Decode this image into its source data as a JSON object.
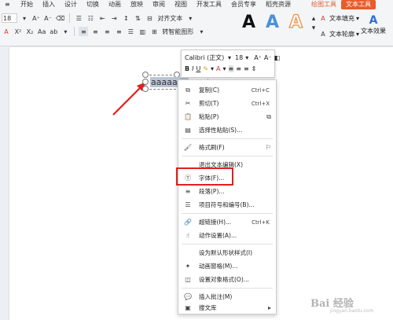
{
  "ribbon": {
    "tabs": [
      "开始",
      "插入",
      "设计",
      "切换",
      "动画",
      "放映",
      "审阅",
      "视图",
      "开发工具",
      "会员专享",
      "稻壳资源"
    ],
    "context_tabs": [
      "绘图工具",
      "文本工具"
    ],
    "font_size": "18",
    "btn_align_text": "对齐文本",
    "btn_smartart": "转智能图形",
    "btn_text_fill": "文本填充",
    "btn_text_outline": "文本轮廓",
    "btn_text_effects": "文本效果",
    "wordart_letters": [
      "A",
      "A",
      "A"
    ],
    "colors": {
      "accent": "#e85d2c",
      "wordart_black": "#111111",
      "wordart_blue": "#4a90d9",
      "wordart_orange": "#f08a3c"
    }
  },
  "minibar": {
    "font_name": "Calibri (正文)",
    "font_size": "18"
  },
  "textbox": {
    "text": "aaaaaaa"
  },
  "menu": {
    "items": [
      {
        "label": "复制(C)",
        "shortcut": "Ctrl+C",
        "icon": "copy-icon",
        "glyph": "⧉"
      },
      {
        "label": "剪切(T)",
        "shortcut": "Ctrl+X",
        "icon": "scissors-icon",
        "glyph": "✂"
      },
      {
        "label": "粘贴(P)",
        "shortcut": "",
        "icon": "paste-icon",
        "glyph": "📋"
      },
      {
        "label": "选择性粘贴(S)...",
        "shortcut": "",
        "icon": "paste-special-icon",
        "glyph": "▤"
      },
      {
        "label": "格式刷(F)",
        "shortcut": "",
        "icon": "format-painter-icon",
        "glyph": "🖌"
      },
      {
        "label": "退出文本编辑(X)",
        "shortcut": "",
        "icon": "",
        "glyph": ""
      },
      {
        "label": "字体(F)...",
        "shortcut": "",
        "icon": "font-icon",
        "glyph": "Ⓣ"
      },
      {
        "label": "段落(P)...",
        "shortcut": "",
        "icon": "paragraph-icon",
        "glyph": "≡"
      },
      {
        "label": "项目符号和编号(B)...",
        "shortcut": "",
        "icon": "bullets-icon",
        "glyph": "☰"
      },
      {
        "label": "超链接(H)...",
        "shortcut": "Ctrl+K",
        "icon": "link-icon",
        "glyph": "🔗"
      },
      {
        "label": "动作设置(A)...",
        "shortcut": "",
        "icon": "action-icon",
        "glyph": "☝"
      },
      {
        "label": "设为默认形状样式(I)",
        "shortcut": "",
        "icon": "",
        "glyph": ""
      },
      {
        "label": "动画窗格(M)...",
        "shortcut": "",
        "icon": "animation-pane-icon",
        "glyph": "✦"
      },
      {
        "label": "设置对象格式(O)...",
        "shortcut": "",
        "icon": "format-object-icon",
        "glyph": "◫"
      },
      {
        "label": "插入批注(M)",
        "shortcut": "",
        "icon": "comment-icon",
        "glyph": "💬"
      },
      {
        "label": "搜文库",
        "shortcut": "",
        "icon": "search-library-icon",
        "glyph": "▣"
      }
    ]
  },
  "watermark": {
    "main": "Bai 经验",
    "sub": "jingyan.baidu.com"
  }
}
